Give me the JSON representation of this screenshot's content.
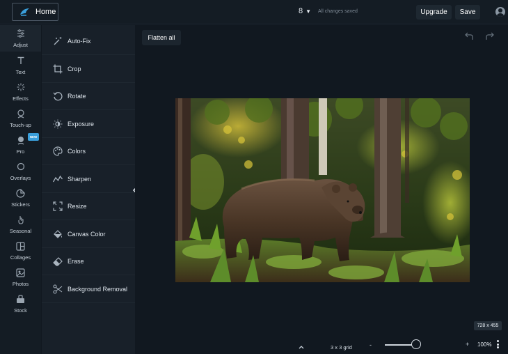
{
  "header": {
    "home_label": "Home",
    "history_count": "8",
    "saved_status": "All changes saved",
    "upgrade_label": "Upgrade",
    "save_label": "Save"
  },
  "rail": {
    "items": [
      {
        "label": "Adjust",
        "icon": "sliders-icon"
      },
      {
        "label": "Text",
        "icon": "text-icon"
      },
      {
        "label": "Effects",
        "icon": "sparkle-icon"
      },
      {
        "label": "Touch-up",
        "icon": "face-icon"
      },
      {
        "label": "Pro",
        "icon": "pro-face-icon",
        "badge": "NEW"
      },
      {
        "label": "Overlays",
        "icon": "circle-icon"
      },
      {
        "label": "Stickers",
        "icon": "sticker-icon"
      },
      {
        "label": "Seasonal",
        "icon": "hand-icon"
      },
      {
        "label": "Collages",
        "icon": "collage-icon"
      },
      {
        "label": "Photos",
        "icon": "photo-icon"
      },
      {
        "label": "Stock",
        "icon": "stock-icon"
      }
    ],
    "active": "Adjust"
  },
  "tools": {
    "items": [
      {
        "label": "Auto-Fix",
        "icon": "magic-wand-icon"
      },
      {
        "label": "Crop",
        "icon": "crop-icon"
      },
      {
        "label": "Rotate",
        "icon": "rotate-icon"
      },
      {
        "label": "Exposure",
        "icon": "sun-icon"
      },
      {
        "label": "Colors",
        "icon": "palette-icon"
      },
      {
        "label": "Sharpen",
        "icon": "sharpen-icon"
      },
      {
        "label": "Resize",
        "icon": "resize-icon"
      },
      {
        "label": "Canvas Color",
        "icon": "paint-bucket-icon"
      },
      {
        "label": "Erase",
        "icon": "eraser-icon"
      },
      {
        "label": "Background Removal",
        "icon": "scissors-icon"
      }
    ]
  },
  "canvas": {
    "flatten_label": "Flatten all",
    "dimensions": "728 x 455"
  },
  "footer": {
    "grid_label": "3 x 3 grid",
    "zoom_minus": "-",
    "zoom_plus": "+",
    "zoom_level": "100%",
    "zoom_fraction": 0.8
  },
  "colors": {
    "background": "#111820",
    "panel": "#182029",
    "rail": "#141c24",
    "accent_badge": "#3a9fdb"
  }
}
